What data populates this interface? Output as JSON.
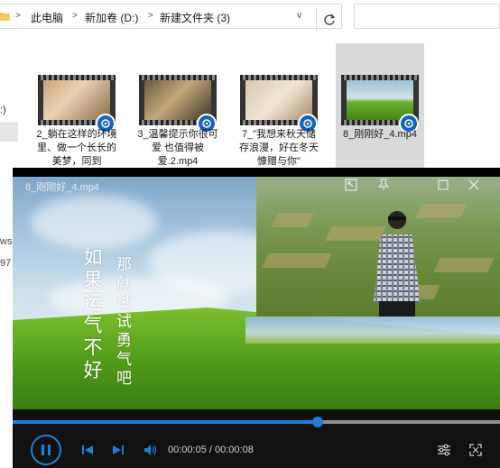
{
  "explorer": {
    "breadcrumbs": [
      "此电脑",
      "新加卷 (D:)",
      "新建文件夹 (3)"
    ],
    "separator": ">",
    "dropdown_glyph": "∨",
    "nav_fragments": [
      ":)",
      "ws",
      "97"
    ],
    "files": [
      {
        "name": "2_躺在这样的环境里、做一个长长的美梦，同到",
        "selected": false
      },
      {
        "name": "3_温馨提示你很可爱 也值得被爱.2.mp4",
        "selected": false
      },
      {
        "name": "7_\"我想来秋天储存浪漫，好在冬天慷赠与你\"",
        "selected": false
      },
      {
        "name": "8_刚刚好_4.mp4",
        "selected": true
      }
    ]
  },
  "player": {
    "title": "8_刚刚好_4.mp4",
    "overlay_text_1": "如果运气不好",
    "overlay_text_2": "那就试试勇气吧",
    "time_current": "00:00:05",
    "time_separator": " / ",
    "time_total": "00:00:08",
    "progress": 0.625,
    "accent_color": "#1e7fd8",
    "icons": [
      "picture-in-picture-icon",
      "pin-icon",
      "maximize-icon",
      "close-icon",
      "pause-icon",
      "previous-icon",
      "next-icon",
      "volume-icon",
      "settings-icon",
      "fullscreen-icon"
    ]
  }
}
